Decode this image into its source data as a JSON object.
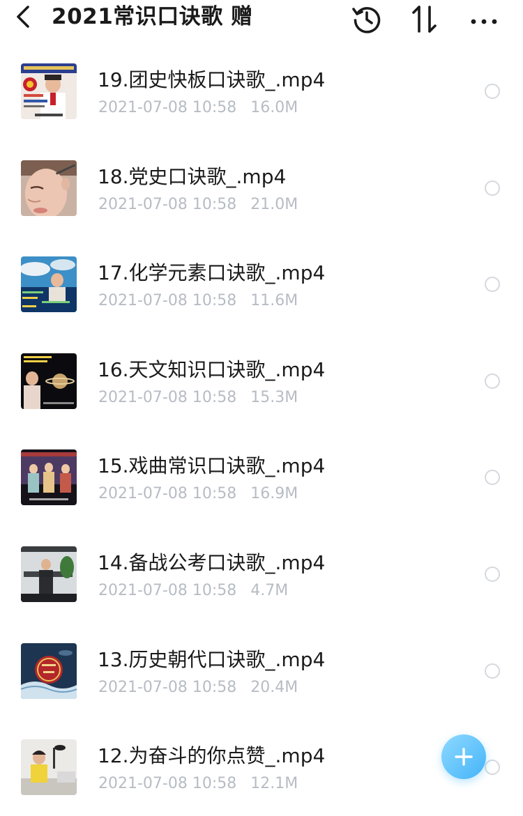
{
  "header": {
    "title": "2021常识口诀歌  赠",
    "icons": [
      "back-arrow-icon",
      "history-icon",
      "sort-icon",
      "more-icon"
    ]
  },
  "files": [
    {
      "name": "19.团史快板口诀歌_.mp4",
      "date": "2021-07-08 10:58",
      "size": "16.0M",
      "thumb": "party-history-presenter"
    },
    {
      "name": "18.党史口诀歌_.mp4",
      "date": "2021-07-08 10:58",
      "size": "21.0M",
      "thumb": "woman-face-makeup"
    },
    {
      "name": "17.化学元素口诀歌_.mp4",
      "date": "2021-07-08 10:58",
      "size": "11.6M",
      "thumb": "blue-sky-presenter"
    },
    {
      "name": "16.天文知识口诀歌_.mp4",
      "date": "2021-07-08 10:58",
      "size": "15.3M",
      "thumb": "saturn-planet"
    },
    {
      "name": "15.戏曲常识口诀歌_.mp4",
      "date": "2021-07-08 10:58",
      "size": "16.9M",
      "thumb": "opera-stage"
    },
    {
      "name": "14.备战公考口诀歌_.mp4",
      "date": "2021-07-08 10:58",
      "size": "4.7M",
      "thumb": "man-classroom"
    },
    {
      "name": "13.历史朝代口诀歌_.mp4",
      "date": "2021-07-08 10:58",
      "size": "20.4M",
      "thumb": "dynasty-emblem"
    },
    {
      "name": "12.为奋斗的你点赞_.mp4",
      "date": "2021-07-08 10:58",
      "size": "12.1M",
      "thumb": "girl-microphone"
    }
  ],
  "fab": {
    "icon": "plus-icon"
  },
  "colors": {
    "accent": "#45b4f9",
    "meta_text": "#b7bcc4",
    "title_text": "#1a1a1a"
  }
}
